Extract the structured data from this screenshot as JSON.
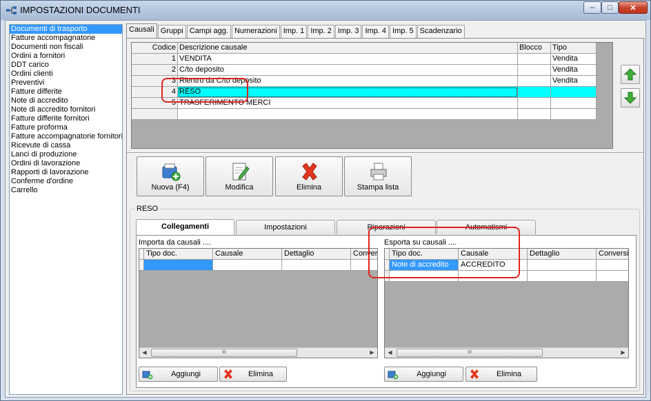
{
  "window": {
    "title": "IMPOSTAZIONI DOCUMENTI",
    "min_label": "–",
    "max_label": "□",
    "close_label": "✕"
  },
  "doc_list": [
    "Documenti di trasporto",
    "Fatture accompagnatorie",
    "Documenti non fiscali",
    "Ordini a fornitori",
    "DDT carico",
    "Ordini clienti",
    "Preventivi",
    "Fatture differite",
    "Note di accredito",
    "Note di accredito fornitori",
    "Fatture differite fornitori",
    "Fatture proforma",
    "Fatture accompagnatorie fornitori",
    "Ricevute di cassa",
    "Lanci di produzione",
    "Ordini di lavorazione",
    "Rapporti di lavorazione",
    "Conferme d'ordine",
    "Carrello"
  ],
  "selected_doc": "Documenti di trasporto",
  "tabs": [
    "Causali",
    "Gruppi",
    "Campi agg.",
    "Numerazioni",
    "Imp. 1",
    "Imp. 2",
    "Imp. 3",
    "Imp. 4",
    "Imp. 5",
    "Scadenzario"
  ],
  "active_tab": "Causali",
  "causali_grid": {
    "headers": {
      "codice": "Codice",
      "descrizione": "Descrizione causale",
      "blocco": "Blocco",
      "tipo": "Tipo"
    },
    "rows": [
      {
        "codice": "1",
        "descrizione": "VENDITA",
        "blocco": "",
        "tipo": "Vendita"
      },
      {
        "codice": "2",
        "descrizione": "C/to deposito",
        "blocco": "",
        "tipo": "Vendita"
      },
      {
        "codice": "3",
        "descrizione": "Rientro da C/to deposito",
        "blocco": "",
        "tipo": "Vendita"
      },
      {
        "codice": "4",
        "descrizione": "RESO",
        "blocco": "",
        "tipo": ""
      },
      {
        "codice": "5",
        "descrizione": "TRASFERIMENTO MERCI",
        "blocco": "",
        "tipo": ""
      }
    ],
    "selected_row": "4"
  },
  "actions": {
    "nuova": "Nuova (F4)",
    "modifica": "Modifica",
    "elimina": "Elimina",
    "stampa": "Stampa lista"
  },
  "detail": {
    "group_title": "RESO",
    "subtabs": [
      "Collegamenti",
      "Impostazioni",
      "Riparazioni",
      "Automatismi"
    ],
    "active_subtab": "Collegamenti",
    "importa": {
      "label": "Importa da causali ....",
      "headers": [
        "Tipo doc.",
        "Causale",
        "Dettaglio",
        "Conversi"
      ],
      "rows": [
        [
          "",
          "",
          "",
          ""
        ]
      ]
    },
    "esporta": {
      "label": "Esporta su causali ....",
      "headers": [
        "Tipo doc.",
        "Causale",
        "Dettaglio",
        "Conversi"
      ],
      "rows": [
        [
          "Note di accredito",
          "ACCREDITO",
          "",
          ""
        ]
      ]
    },
    "aggiungi": "Aggiungi",
    "elimina": "Elimina",
    "scroll_thumb": "III"
  },
  "colors": {
    "selection_blue": "#3399ff",
    "highlight_cyan": "#00ffff",
    "annotation_red": "#e0221c"
  }
}
